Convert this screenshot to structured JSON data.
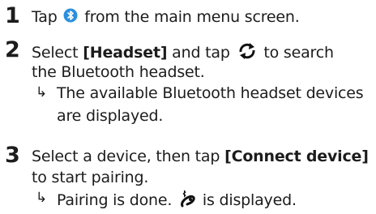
{
  "steps": [
    {
      "number": "1",
      "text_before": "Tap",
      "icon": "bluetooth-icon",
      "text_after": "from the main menu screen."
    },
    {
      "number": "2",
      "text_a": "Select",
      "bracket_headset": "[Headset]",
      "text_b": "and tap",
      "icon": "refresh-icon",
      "text_c": "to search",
      "line2": "the Bluetooth headset.",
      "result_arrow": "↳",
      "result_line1": "The available Bluetooth headset devices",
      "result_line2": "are displayed."
    },
    {
      "number": "3",
      "text_a": "Select a device, then tap",
      "bracket_connect": "[Connect device]",
      "line2": "to start pairing.",
      "result_arrow": "↳",
      "result_before": "Pairing is done.",
      "icon": "bluetooth-headset-icon",
      "result_after": "is displayed."
    }
  ],
  "colors": {
    "bluetooth_icon_bg": "#2a8fe0",
    "text": "#1c1c1c"
  }
}
